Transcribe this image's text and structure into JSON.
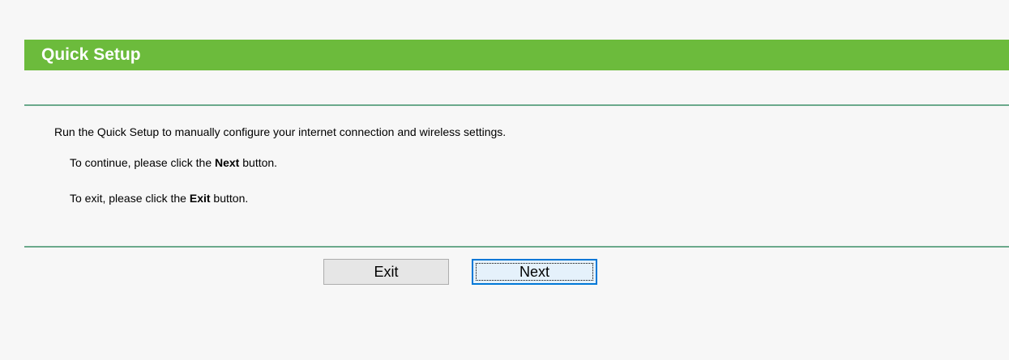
{
  "header": {
    "title": "Quick Setup"
  },
  "content": {
    "intro": "Run the Quick Setup to manually configure your internet connection and wireless settings.",
    "continue_prefix": "To continue, please click the ",
    "continue_bold": "Next",
    "continue_suffix": " button.",
    "exit_prefix": "To exit, please click the ",
    "exit_bold": "Exit",
    "exit_suffix": " button."
  },
  "buttons": {
    "exit_label": "Exit",
    "next_label": "Next",
    "focused": "Next"
  },
  "colors": {
    "header_background": "#6cbb3c",
    "header_text": "#ffffff",
    "divider": "#6ba98b",
    "page_background": "#f7f7f7",
    "focused_button_border": "#0078d7"
  }
}
